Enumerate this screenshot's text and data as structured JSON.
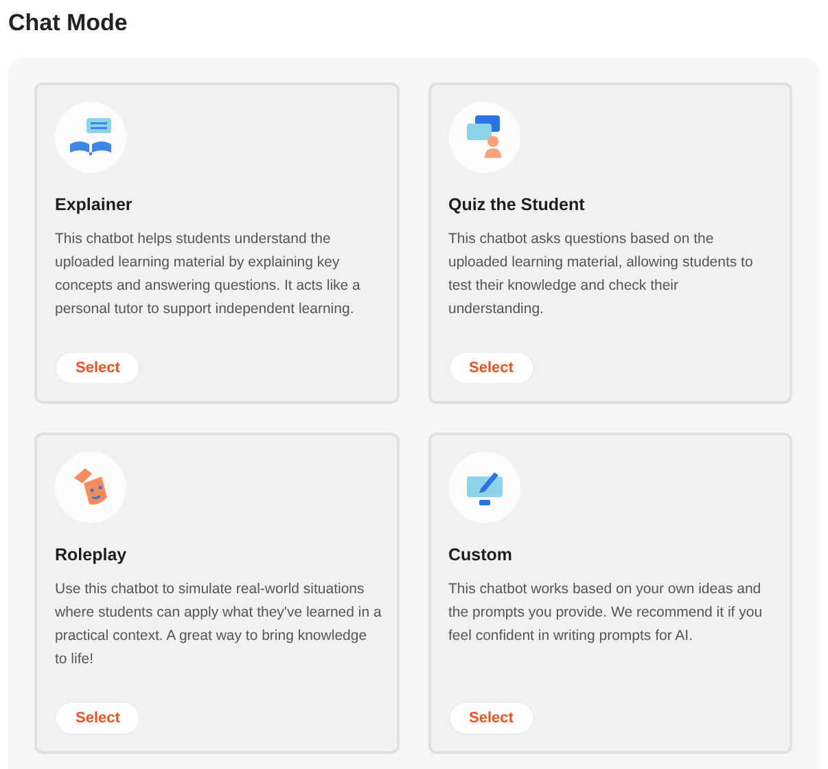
{
  "heading": "Chat Mode",
  "modes": [
    {
      "kind": "book",
      "title": "Explainer",
      "description": "This chatbot helps students understand the uploaded learning material by explaining key concepts and answering questions. It acts like a personal tutor to support independent learning.",
      "button": "Select"
    },
    {
      "kind": "quiz",
      "title": "Quiz the Student",
      "description": "This chatbot asks questions based on the uploaded learning material, allowing students to test their knowledge and check their understanding.",
      "button": "Select"
    },
    {
      "kind": "mask",
      "title": "Roleplay",
      "description": "Use this chatbot to simulate real-world situations where students can apply what they've learned in a practical context. A great way to bring knowledge to life!",
      "button": "Select"
    },
    {
      "kind": "monitor",
      "title": "Custom",
      "description": "This chatbot works based on your own ideas and the prompts you provide. We recommend it if you feel confident in writing prompts for AI.",
      "button": "Select"
    }
  ]
}
